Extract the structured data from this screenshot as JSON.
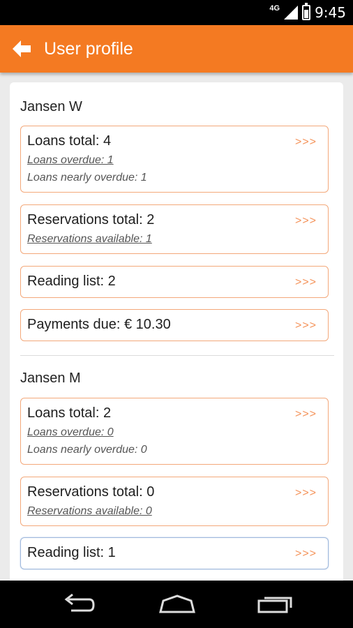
{
  "status_bar": {
    "network": "4G",
    "time": "9:45"
  },
  "app_bar": {
    "title": "User profile"
  },
  "users": [
    {
      "name": "Jansen W",
      "loans": {
        "total": "Loans total: 4",
        "overdue": "Loans overdue: 1",
        "nearly_overdue": "Loans nearly overdue: 1"
      },
      "reservations": {
        "total": "Reservations total: 2",
        "available": "Reservations available: 1"
      },
      "reading_list": "Reading list: 2",
      "payments": "Payments due: € 10.30"
    },
    {
      "name": "Jansen M",
      "loans": {
        "total": "Loans total: 2",
        "overdue": "Loans overdue: 0",
        "nearly_overdue": "Loans nearly overdue: 0"
      },
      "reservations": {
        "total": "Reservations total: 0",
        "available": "Reservations available: 0"
      },
      "reading_list": "Reading list: 1"
    }
  ],
  "arrow_label": ">>>",
  "icons": {
    "back": "arrow-left-icon",
    "nav_back": "nav-back-icon",
    "nav_home": "nav-home-icon",
    "nav_recents": "nav-recents-icon"
  },
  "colors": {
    "accent": "#f47a22",
    "card_border": "#f3a87a",
    "arrow": "#f4935a"
  }
}
